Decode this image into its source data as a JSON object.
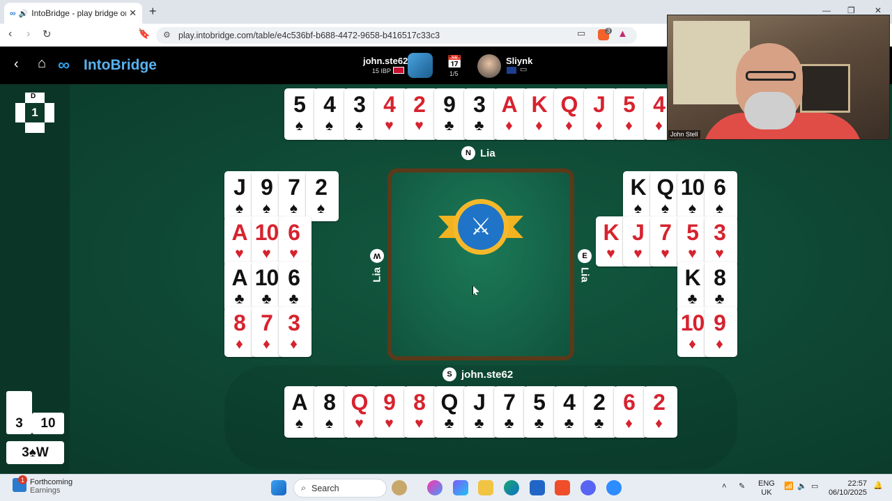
{
  "browser": {
    "tab_title": "IntoBridge - play bridge onlin",
    "tab_icon": "infinity-icon",
    "url": "play.intobridge.com/table/e4c536bf-b688-4472-9658-b416517c33c3",
    "extension_badge": "3"
  },
  "header": {
    "brand": "IntoBridge",
    "player_left": {
      "name": "john.ste62",
      "ibp": "15 IBP"
    },
    "board_counter": "1/5",
    "player_right": {
      "name": "Sliynk"
    }
  },
  "table": {
    "board_number": "1",
    "dealer_label": "D",
    "north": {
      "seat": "N",
      "name": "Lia"
    },
    "west": {
      "seat": "W",
      "name": "Lia"
    },
    "east": {
      "seat": "E",
      "name": "Lia"
    },
    "south": {
      "seat": "S",
      "name": "john.ste62"
    },
    "north_cards": [
      {
        "r": "5",
        "s": "♠",
        "c": "blk"
      },
      {
        "r": "4",
        "s": "♠",
        "c": "blk"
      },
      {
        "r": "3",
        "s": "♠",
        "c": "blk"
      },
      {
        "r": "4",
        "s": "♥",
        "c": "red"
      },
      {
        "r": "2",
        "s": "♥",
        "c": "red"
      },
      {
        "r": "9",
        "s": "♣",
        "c": "blk"
      },
      {
        "r": "3",
        "s": "♣",
        "c": "blk"
      },
      {
        "r": "A",
        "s": "♦",
        "c": "red"
      },
      {
        "r": "K",
        "s": "♦",
        "c": "red"
      },
      {
        "r": "Q",
        "s": "♦",
        "c": "red"
      },
      {
        "r": "J",
        "s": "♦",
        "c": "red"
      },
      {
        "r": "5",
        "s": "♦",
        "c": "red"
      },
      {
        "r": "4",
        "s": "♦",
        "c": "red"
      }
    ],
    "west_rows": [
      [
        {
          "r": "J",
          "s": "♠",
          "c": "blk"
        },
        {
          "r": "9",
          "s": "♠",
          "c": "blk"
        },
        {
          "r": "7",
          "s": "♠",
          "c": "blk"
        },
        {
          "r": "2",
          "s": "♠",
          "c": "blk"
        }
      ],
      [
        {
          "r": "A",
          "s": "♥",
          "c": "red"
        },
        {
          "r": "10",
          "s": "♥",
          "c": "red"
        },
        {
          "r": "6",
          "s": "♥",
          "c": "red"
        }
      ],
      [
        {
          "r": "A",
          "s": "♣",
          "c": "blk"
        },
        {
          "r": "10",
          "s": "♣",
          "c": "blk"
        },
        {
          "r": "6",
          "s": "♣",
          "c": "blk"
        }
      ],
      [
        {
          "r": "8",
          "s": "♦",
          "c": "red"
        },
        {
          "r": "7",
          "s": "♦",
          "c": "red"
        },
        {
          "r": "3",
          "s": "♦",
          "c": "red"
        }
      ]
    ],
    "east_rows": [
      [
        {
          "r": "K",
          "s": "♠",
          "c": "blk"
        },
        {
          "r": "Q",
          "s": "♠",
          "c": "blk"
        },
        {
          "r": "10",
          "s": "♠",
          "c": "blk"
        },
        {
          "r": "6",
          "s": "♠",
          "c": "blk"
        }
      ],
      [
        {
          "r": "K",
          "s": "♥",
          "c": "red"
        },
        {
          "r": "J",
          "s": "♥",
          "c": "red"
        },
        {
          "r": "7",
          "s": "♥",
          "c": "red"
        },
        {
          "r": "5",
          "s": "♥",
          "c": "red"
        },
        {
          "r": "3",
          "s": "♥",
          "c": "red"
        }
      ],
      [
        {
          "r": "K",
          "s": "♣",
          "c": "blk"
        },
        {
          "r": "8",
          "s": "♣",
          "c": "blk"
        }
      ],
      [
        {
          "r": "10",
          "s": "♦",
          "c": "red"
        },
        {
          "r": "9",
          "s": "♦",
          "c": "red"
        }
      ]
    ],
    "south_cards": [
      {
        "r": "A",
        "s": "♠",
        "c": "blk"
      },
      {
        "r": "8",
        "s": "♠",
        "c": "blk"
      },
      {
        "r": "Q",
        "s": "♥",
        "c": "red"
      },
      {
        "r": "9",
        "s": "♥",
        "c": "red"
      },
      {
        "r": "8",
        "s": "♥",
        "c": "red"
      },
      {
        "r": "Q",
        "s": "♣",
        "c": "blk"
      },
      {
        "r": "J",
        "s": "♣",
        "c": "blk"
      },
      {
        "r": "7",
        "s": "♣",
        "c": "blk"
      },
      {
        "r": "5",
        "s": "♣",
        "c": "blk"
      },
      {
        "r": "4",
        "s": "♣",
        "c": "blk"
      },
      {
        "r": "2",
        "s": "♣",
        "c": "blk"
      },
      {
        "r": "6",
        "s": "♦",
        "c": "red"
      },
      {
        "r": "2",
        "s": "♦",
        "c": "red"
      }
    ],
    "tricks_ns": "3",
    "tricks_ew": "10",
    "contract": "3♠W"
  },
  "video": {
    "caption": "John Stell"
  },
  "taskbar": {
    "weather_badge": "1",
    "weather_line1": "Forthcoming",
    "weather_line2": "Earnings",
    "search_placeholder": "Search",
    "lang1": "ENG",
    "lang2": "UK",
    "time": "22:57",
    "date": "06/10/2025"
  }
}
